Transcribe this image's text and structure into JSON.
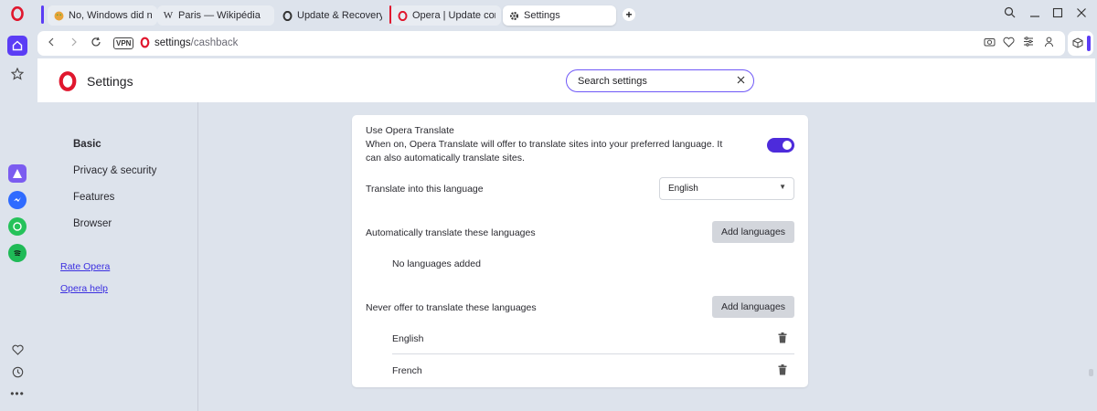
{
  "browser": {
    "tabs": [
      {
        "title": "No, Windows did not lose",
        "favicon": "emoji-face-icon"
      },
      {
        "title": "Paris — Wikipédia",
        "favicon": "wikipedia-w-icon"
      },
      {
        "title": "Update & Recovery",
        "favicon": "opera-dark-icon"
      },
      {
        "title": "Opera | Update complete",
        "favicon": "opera-red-icon"
      },
      {
        "title": "Settings",
        "favicon": "gear-icon"
      }
    ],
    "address": {
      "vpn": "VPN",
      "url_host": "settings",
      "url_path": "/cashback"
    }
  },
  "page": {
    "title": "Settings",
    "search": {
      "value": "Search settings"
    }
  },
  "settings_nav": {
    "items": [
      {
        "label": "Basic",
        "bold": true
      },
      {
        "label": "Privacy & security"
      },
      {
        "label": "Features"
      },
      {
        "label": "Browser"
      }
    ],
    "links": [
      {
        "label": "Rate Opera"
      },
      {
        "label": "Opera help"
      }
    ]
  },
  "translate": {
    "heading": "Use Opera Translate",
    "description": "When on, Opera Translate will offer to translate sites into your preferred language. It can also automatically translate sites.",
    "enabled": true,
    "target_label": "Translate into this language",
    "target_value": "English",
    "auto_label": "Automatically translate these languages",
    "auto_button": "Add languages",
    "auto_empty": "No languages added",
    "never_label": "Never offer to translate these languages",
    "never_button": "Add languages",
    "never_languages": [
      "English",
      "French"
    ]
  },
  "colors": {
    "accent": "#5b3df5",
    "toggle": "#4d2bdb",
    "opera_red": "#e0172e"
  }
}
